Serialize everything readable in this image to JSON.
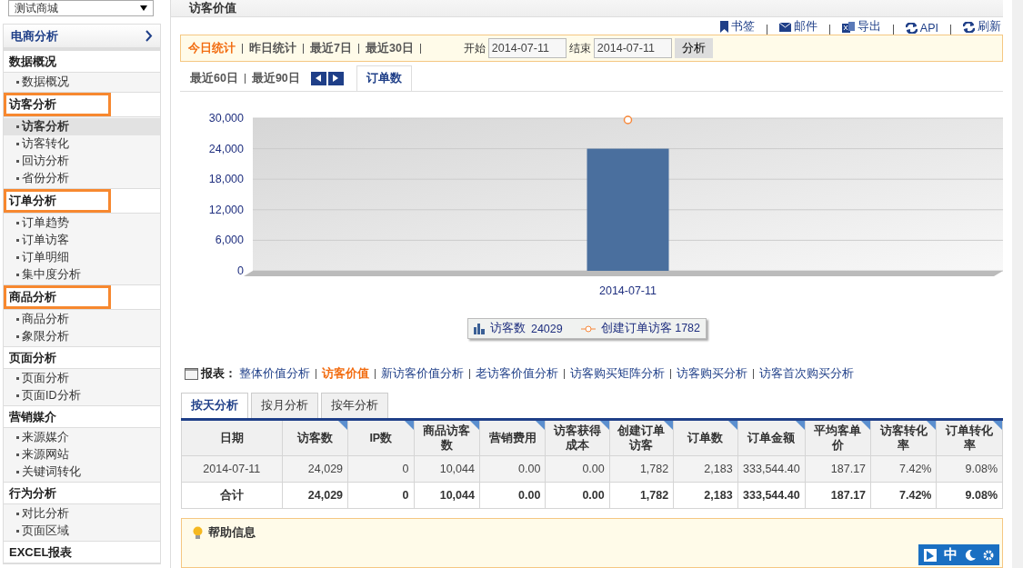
{
  "store_select": {
    "value": "测试商城"
  },
  "sidebar": {
    "title": "电商分析",
    "groups": [
      {
        "label": "数据概况",
        "highlighted": false,
        "items": [
          {
            "label": "数据概况",
            "selected": false
          }
        ]
      },
      {
        "label": "访客分析",
        "highlighted": true,
        "items": [
          {
            "label": "访客分析",
            "selected": true
          },
          {
            "label": "访客转化",
            "selected": false
          },
          {
            "label": "回访分析",
            "selected": false
          },
          {
            "label": "省份分析",
            "selected": false
          }
        ]
      },
      {
        "label": "订单分析",
        "highlighted": true,
        "items": [
          {
            "label": "订单趋势",
            "selected": false
          },
          {
            "label": "订单访客",
            "selected": false
          },
          {
            "label": "订单明细",
            "selected": false
          },
          {
            "label": "集中度分析",
            "selected": false
          }
        ]
      },
      {
        "label": "商品分析",
        "highlighted": true,
        "items": [
          {
            "label": "商品分析",
            "selected": false
          },
          {
            "label": "象限分析",
            "selected": false
          }
        ]
      },
      {
        "label": "页面分析",
        "highlighted": false,
        "items": [
          {
            "label": "页面分析",
            "selected": false
          },
          {
            "label": "页面ID分析",
            "selected": false
          }
        ]
      },
      {
        "label": "营销媒介",
        "highlighted": false,
        "items": [
          {
            "label": "来源媒介",
            "selected": false
          },
          {
            "label": "来源网站",
            "selected": false
          },
          {
            "label": "关键词转化",
            "selected": false
          }
        ]
      },
      {
        "label": "行为分析",
        "highlighted": false,
        "items": [
          {
            "label": "对比分析",
            "selected": false
          },
          {
            "label": "页面区域",
            "selected": false
          }
        ]
      },
      {
        "label": "EXCEL报表",
        "highlighted": false
      }
    ]
  },
  "page_title": "访客价值",
  "toolbar": [
    {
      "kind": "bookmark",
      "label": "书签"
    },
    {
      "kind": "mail",
      "label": "邮件"
    },
    {
      "kind": "export",
      "label": "导出"
    },
    {
      "kind": "refresh",
      "label": "API"
    },
    {
      "kind": "refresh",
      "label": "刷新"
    }
  ],
  "periods": [
    {
      "label": "今日统计",
      "selected": true
    },
    {
      "label": "昨日统计",
      "selected": false
    },
    {
      "label": "最近7日",
      "selected": false
    },
    {
      "label": "最近30日",
      "selected": false
    }
  ],
  "periods_2": [
    {
      "label": "最近60日",
      "selected": false
    },
    {
      "label": "最近90日",
      "selected": false
    }
  ],
  "date_range": {
    "start_label": "开始",
    "start": "2014-07-11",
    "end_label": "结束",
    "end": "2014-07-11",
    "button": "分析"
  },
  "chart_tabs": [
    {
      "label": "订单数",
      "selected": true
    }
  ],
  "chart_data": {
    "type": "bar",
    "grid": true,
    "categories": [
      "2014-07-11"
    ],
    "ylim": [
      0,
      30000
    ],
    "yticks": [
      {
        "value": 0,
        "label": "0"
      },
      {
        "value": 6000,
        "label": "6,000"
      },
      {
        "value": 12000,
        "label": "12,000"
      },
      {
        "value": 18000,
        "label": "18,000"
      },
      {
        "value": 24000,
        "label": "24,000"
      },
      {
        "value": 30000,
        "label": "30,000"
      }
    ],
    "series": [
      {
        "name": "访客数",
        "color": "#4a6f9e",
        "values": [
          24000
        ]
      }
    ]
  },
  "legend": [
    {
      "kind": "bar",
      "value": "24029"
    },
    {
      "kind": "line",
      "label": "创建订单访客 1782"
    }
  ],
  "reports": {
    "label": "报表：",
    "links": [
      {
        "label": "整体价值分析",
        "selected": false
      },
      {
        "label": "访客价值",
        "selected": true
      },
      {
        "label": "新访客价值分析",
        "selected": false
      },
      {
        "label": "老访客价值分析",
        "selected": false
      },
      {
        "label": "访客购买矩阵分析",
        "selected": false
      },
      {
        "label": "访客购买分析",
        "selected": false
      },
      {
        "label": "访客首次购买分析",
        "selected": false
      }
    ]
  },
  "table_tabs": [
    {
      "label": "按天分析",
      "selected": true
    },
    {
      "label": "按月分析",
      "selected": false
    },
    {
      "label": "按年分析",
      "selected": false
    }
  ],
  "table": {
    "columns": [
      "日期",
      "访客数",
      "IP数",
      "商品访客数",
      "营销费用",
      "访客获得成本",
      "创建订单访客",
      "订单数",
      "订单金额",
      "平均客单价",
      "访客转化率",
      "订单转化率"
    ],
    "rows": [
      {
        "kind": "data",
        "cells": [
          "2014-07-11",
          "24,029",
          "0",
          "10,044",
          "0.00",
          "0.00",
          "1,782",
          "2,183",
          "333,544.40",
          "187.17",
          "7.42%",
          "9.08%"
        ]
      },
      {
        "kind": "total",
        "cells": [
          "合计",
          "24,029",
          "0",
          "10,044",
          "0.00",
          "0.00",
          "1,782",
          "2,183",
          "333,544.40",
          "187.17",
          "7.42%",
          "9.08%"
        ]
      }
    ]
  },
  "help": {
    "title": "帮助信息"
  },
  "ime_bar": {
    "label": "中"
  }
}
